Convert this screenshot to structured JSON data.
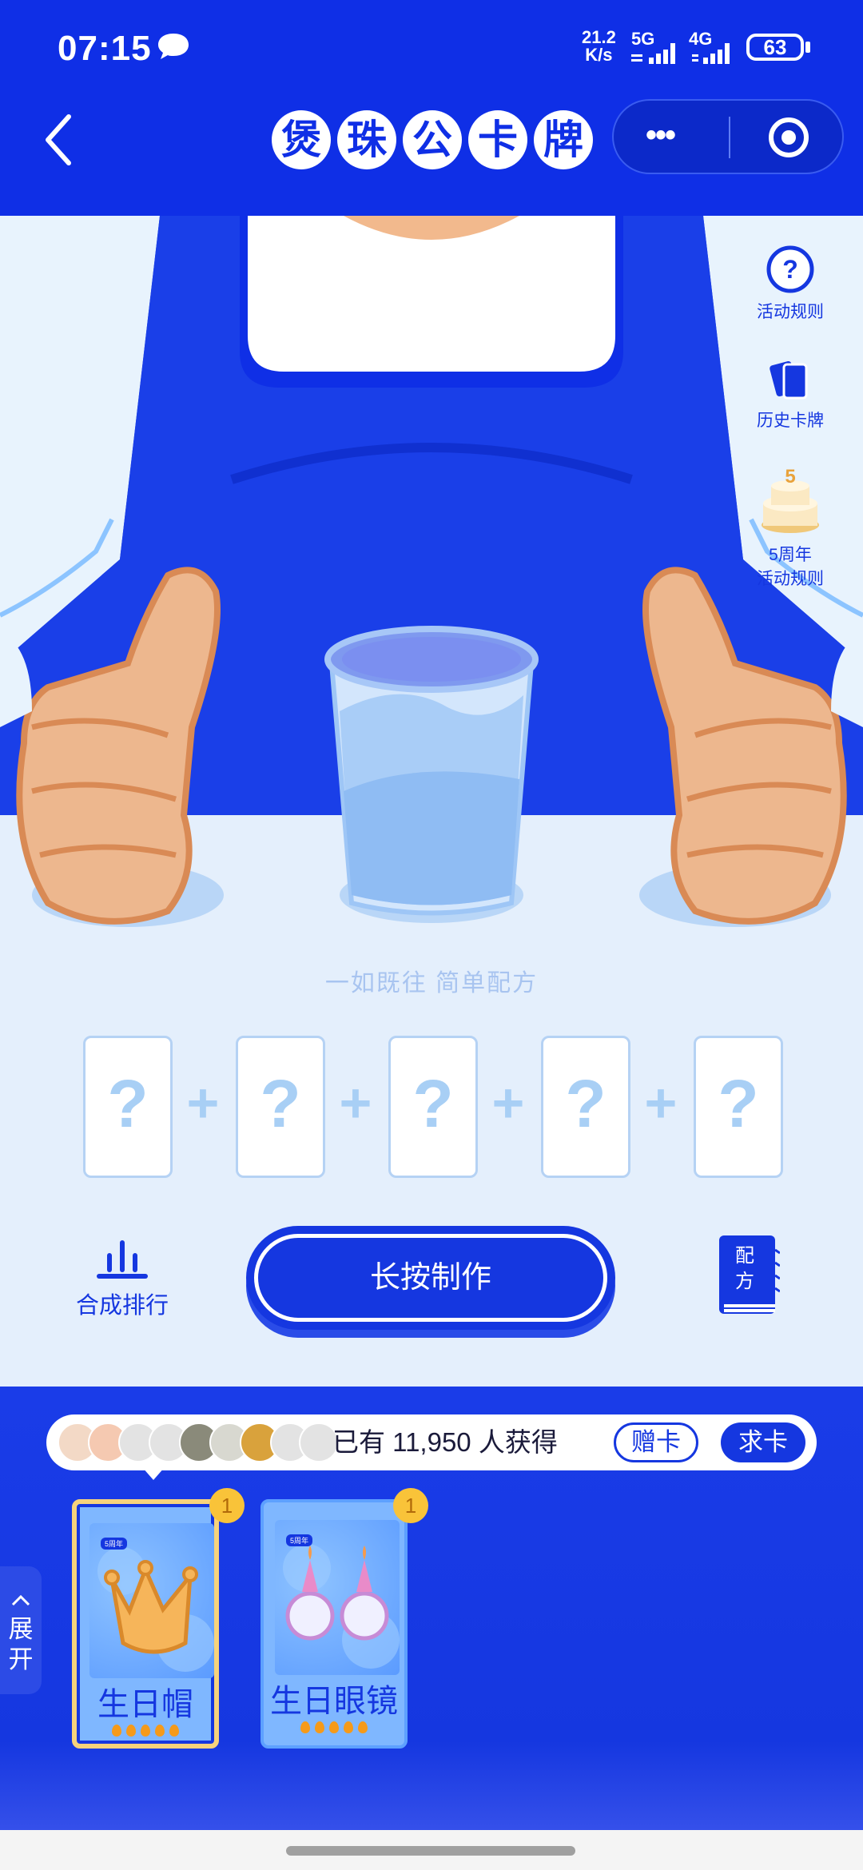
{
  "status_bar": {
    "time": "07:15",
    "net_speed_value": "21.2",
    "net_speed_unit": "K/s",
    "gen1": "5G",
    "gen2": "4G",
    "battery": "63"
  },
  "header": {
    "title_chars": [
      "煲",
      "珠",
      "公",
      "卡",
      "牌"
    ]
  },
  "side_menu": {
    "rules": "活动规则",
    "history": "历史卡牌",
    "anniversary_line1": "5周年",
    "anniversary_line2": "活动规则"
  },
  "craft": {
    "tagline": "一如既往 简单配方",
    "slot_placeholder": "?",
    "plus": "+",
    "rank_label": "合成排行",
    "make_button": "长按制作",
    "recipe_line1": "配",
    "recipe_line2": "方"
  },
  "bottom": {
    "count_text": "已有 11,950 人获得",
    "gift_button": "赠卡",
    "ask_button": "求卡",
    "expand_label_1": "展",
    "expand_label_2": "开",
    "cards": [
      {
        "name": "生日帽",
        "count": "1",
        "badge": "5周年"
      },
      {
        "name": "生日眼镜",
        "count": "1",
        "badge": "5周年"
      }
    ]
  },
  "colors": {
    "brand_blue": "#1537e0",
    "light_bg": "#e4effc",
    "badge_yellow": "#f9c339"
  }
}
